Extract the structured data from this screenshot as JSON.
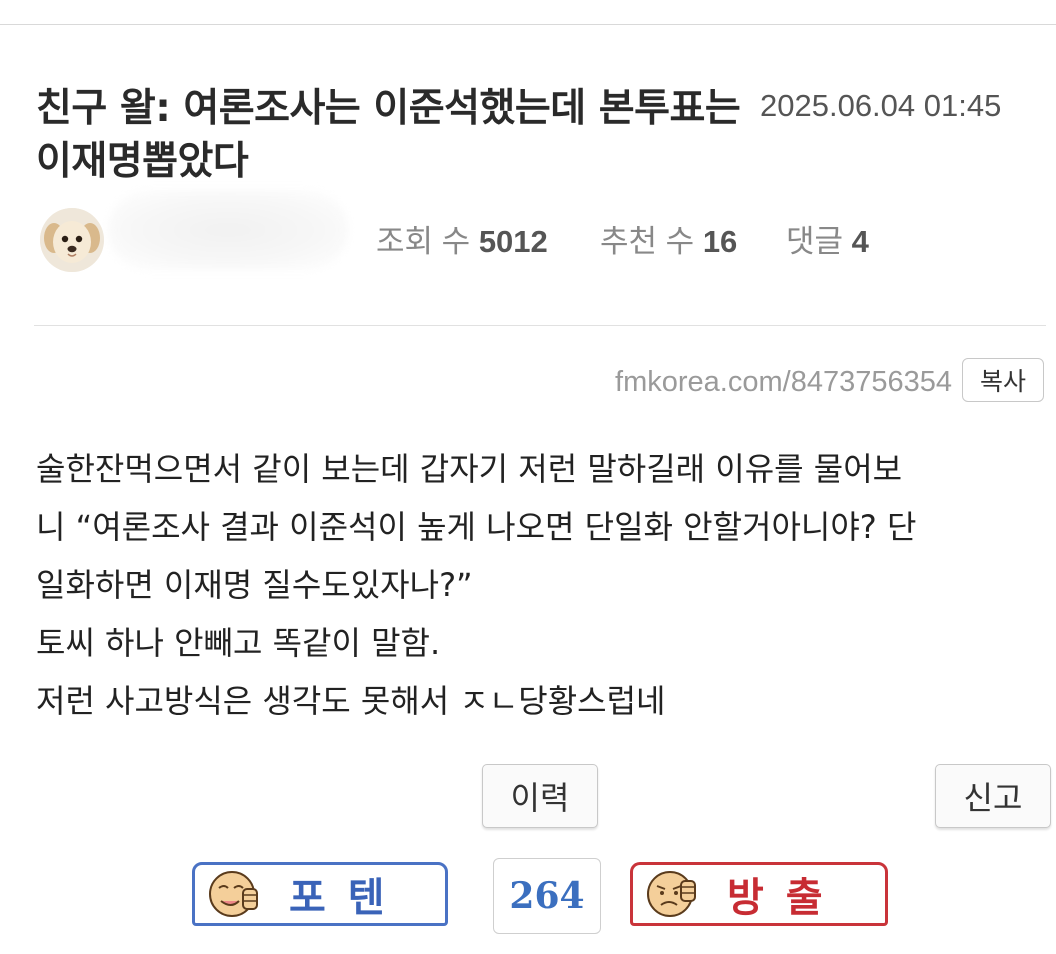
{
  "post": {
    "title": "친구 왈: 여론조사는 이준석했는데 본투표는 이재명뽑았다",
    "date": "2025.06.04 01:45",
    "author_name": "",
    "stats": {
      "views_label": "조회 수",
      "views": "5012",
      "recommend_label": "추천 수",
      "recommend": "16",
      "comments_label": "댓글",
      "comments": "4"
    },
    "url": "fmkorea.com/8473756354",
    "copy_label": "복사",
    "body_lines": [
      "술한잔먹으면서 같이 보는데 갑자기 저런 말하길래 이유를 물어보",
      "니 “여론조사 결과 이준석이 높게 나오면 단일화 안할거아니야? 단",
      "일화하면 이재명 질수도있자나?”",
      "토씨 하나 안빼고 똑같이 말함.",
      "저런 사고방식은 생각도 못해서 ㅈㄴ당황스럽네"
    ]
  },
  "actions": {
    "history_label": "이력",
    "report_label": "신고",
    "upvote_label": "포텐",
    "vote_count": "264",
    "downvote_label": "방출"
  },
  "colors": {
    "upvote_border": "#4a72c4",
    "upvote_text": "#3a63b8",
    "downvote_border": "#c9343a",
    "downvote_text": "#c72c33",
    "count_text": "#3b6fbf"
  },
  "icons": {
    "avatar": "puppy-avatar",
    "upvote_face": "thumbs-up-face-icon",
    "downvote_face": "thumbs-down-face-icon"
  }
}
